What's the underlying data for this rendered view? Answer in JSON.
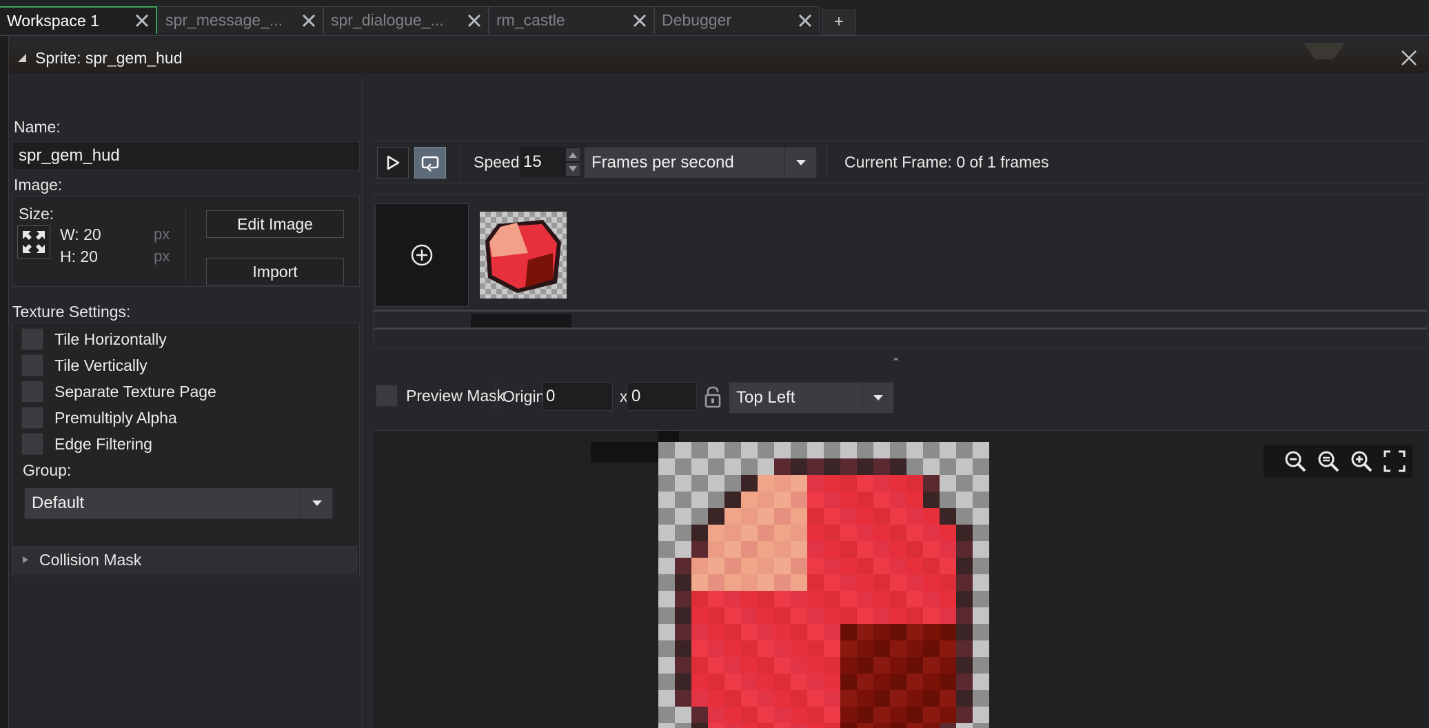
{
  "tabs": [
    {
      "label": "Workspace 1",
      "active": true
    },
    {
      "label": "spr_message_...",
      "active": false
    },
    {
      "label": "spr_dialogue_...",
      "active": false
    },
    {
      "label": "rm_castle",
      "active": false
    },
    {
      "label": "Debugger",
      "active": false
    }
  ],
  "add_tab_label": "+",
  "window": {
    "title": "Sprite: spr_gem_hud"
  },
  "left": {
    "name_label": "Name:",
    "name_value": "spr_gem_hud",
    "image_label": "Image:",
    "size_label": "Size:",
    "width": "W: 20",
    "height": "H: 20",
    "unit": "px",
    "edit_image_button": "Edit Image",
    "import_button": "Import",
    "texture_settings_label": "Texture Settings:",
    "texture_options": [
      {
        "label": "Tile Horizontally",
        "checked": false
      },
      {
        "label": "Tile Vertically",
        "checked": false
      },
      {
        "label": "Separate Texture Page",
        "checked": false
      },
      {
        "label": "Premultiply Alpha",
        "checked": false
      },
      {
        "label": "Edge Filtering",
        "checked": false
      }
    ],
    "group_label": "Group:",
    "group_value": "Default",
    "collision_mask_label": "Collision Mask"
  },
  "playback": {
    "speed_label": "Speed:",
    "speed_value": "15",
    "speed_unit": "Frames per second",
    "current_frame": "Current Frame: 0 of 1 frames"
  },
  "origin": {
    "preview_mask_label": "Preview Mask",
    "origin_label": "Origin:",
    "x_value": "0",
    "separator": "x",
    "y_value": "0",
    "anchor": "Top Left"
  },
  "colors": {
    "accent_tab": "#3fa35a",
    "gem_red": "#e8303c",
    "gem_highlight": "#f0a68a",
    "gem_dark": "#7a1208",
    "toggle_on": "#5d6a78"
  },
  "icons": [
    "play-icon",
    "loop-icon",
    "add-frame-icon",
    "resize-icon",
    "lock-icon",
    "zoom-out-icon",
    "zoom-reset-icon",
    "zoom-in-icon",
    "fullscreen-icon",
    "close-icon",
    "chevron-down-icon",
    "expand-arrow-icon"
  ]
}
